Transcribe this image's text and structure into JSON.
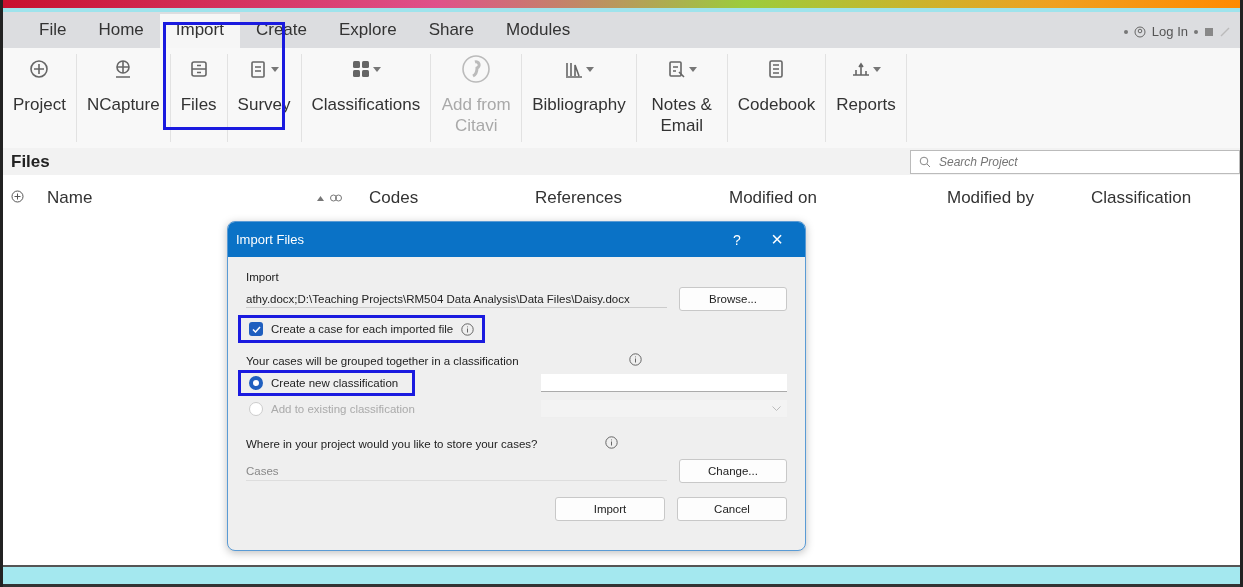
{
  "menu_tabs": [
    {
      "label": "File",
      "selected": false
    },
    {
      "label": "Home",
      "selected": false
    },
    {
      "label": "Import",
      "selected": true
    },
    {
      "label": "Create",
      "selected": false
    },
    {
      "label": "Explore",
      "selected": false
    },
    {
      "label": "Share",
      "selected": false
    },
    {
      "label": "Modules",
      "selected": false
    }
  ],
  "account": {
    "label": "Log In"
  },
  "ribbon": [
    {
      "label": "Project",
      "dropdown": false,
      "disabled": false
    },
    {
      "label": "NCapture",
      "dropdown": false,
      "disabled": false
    },
    {
      "label": "Files",
      "dropdown": false,
      "disabled": false
    },
    {
      "label": "Survey",
      "dropdown": true,
      "disabled": false
    },
    {
      "label": "Classifications",
      "dropdown": true,
      "disabled": false
    },
    {
      "label": "Add from Citavi",
      "dropdown": false,
      "disabled": true
    },
    {
      "label": "Bibliography",
      "dropdown": true,
      "disabled": false
    },
    {
      "label": "Notes & Email",
      "dropdown": true,
      "disabled": false
    },
    {
      "label": "Codebook",
      "dropdown": false,
      "disabled": false
    },
    {
      "label": "Reports",
      "dropdown": true,
      "disabled": false
    }
  ],
  "panel": {
    "title": "Files",
    "search": {
      "placeholder": "Search Project"
    }
  },
  "table": {
    "columns": [
      "Name",
      "Codes",
      "References",
      "Modified on",
      "Modified by",
      "Classification"
    ]
  },
  "dialog": {
    "title": "Import Files",
    "help": "?",
    "close": "×",
    "import_label": "Import",
    "import_path": "athy.docx;D:\\Teaching Projects\\RM504 Data Analysis\\Data Files\\Daisy.docx",
    "browse": "Browse...",
    "case_checkbox": {
      "label": "Create a case for each imported file",
      "checked": true,
      "highlighted": true
    },
    "group_text": "Your cases will be grouped together in a classification",
    "options": [
      {
        "label": "Create new classification",
        "selected": true,
        "disabled": false,
        "highlighted": true,
        "kind": "text"
      },
      {
        "label": "Add to existing classification",
        "selected": false,
        "disabled": true,
        "highlighted": false,
        "kind": "dropdown"
      }
    ],
    "store_text": "Where in your project would you like to store your cases?",
    "location": "Cases",
    "change": "Change...",
    "buttons": [
      "Import",
      "Cancel"
    ]
  }
}
